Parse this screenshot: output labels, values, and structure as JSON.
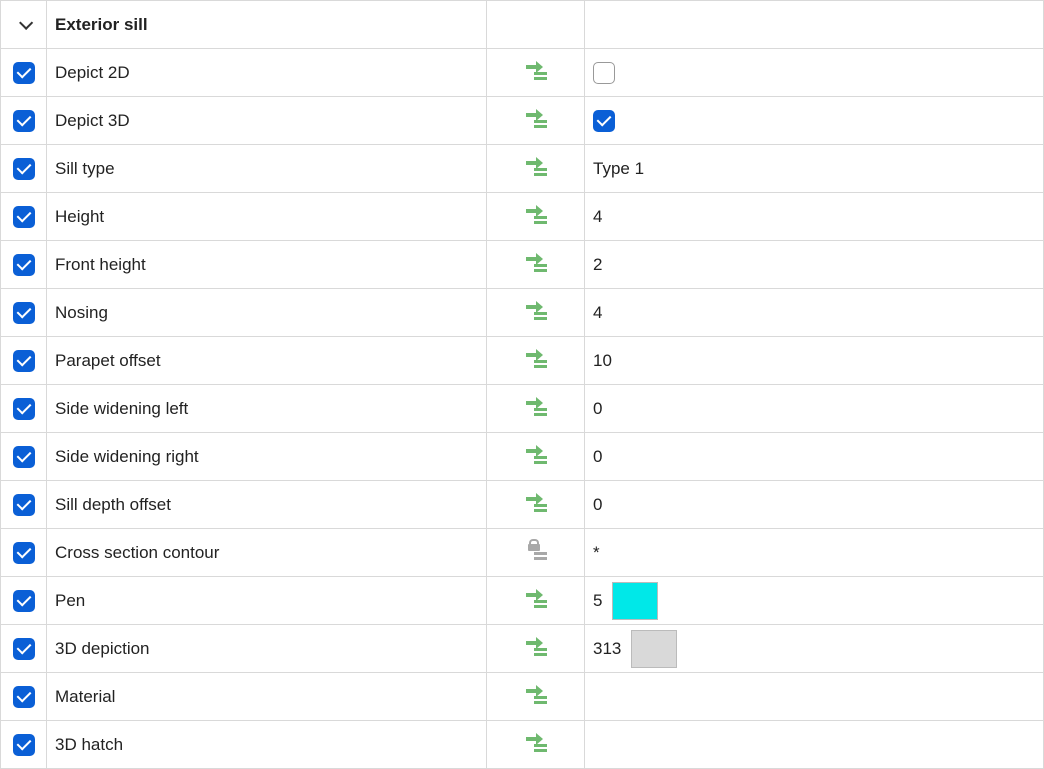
{
  "section": {
    "title": "Exterior sill",
    "expanded": true
  },
  "rows": [
    {
      "enabled": true,
      "label": "Depict 2D",
      "icon": "transfer",
      "value_type": "checkbox",
      "value_checked": false
    },
    {
      "enabled": true,
      "label": "Depict 3D",
      "icon": "transfer",
      "value_type": "checkbox",
      "value_checked": true
    },
    {
      "enabled": true,
      "label": "Sill type",
      "icon": "transfer",
      "value_type": "text",
      "value": "Type 1"
    },
    {
      "enabled": true,
      "label": "Height",
      "icon": "transfer",
      "value_type": "text",
      "value": "4"
    },
    {
      "enabled": true,
      "label": "Front height",
      "icon": "transfer",
      "value_type": "text",
      "value": "2"
    },
    {
      "enabled": true,
      "label": "Nosing",
      "icon": "transfer",
      "value_type": "text",
      "value": "4"
    },
    {
      "enabled": true,
      "label": "Parapet offset",
      "icon": "transfer",
      "value_type": "text",
      "value": "10"
    },
    {
      "enabled": true,
      "label": "Side widening left",
      "icon": "transfer",
      "value_type": "text",
      "value": "0"
    },
    {
      "enabled": true,
      "label": "Side widening right",
      "icon": "transfer",
      "value_type": "text",
      "value": "0"
    },
    {
      "enabled": true,
      "label": "Sill depth offset",
      "icon": "transfer",
      "value_type": "text",
      "value": "0"
    },
    {
      "enabled": true,
      "label": "Cross section contour",
      "icon": "lock",
      "value_type": "text",
      "value": "*"
    },
    {
      "enabled": true,
      "label": "Pen",
      "icon": "transfer",
      "value_type": "swatch",
      "value": "5",
      "swatch_color": "#00e8e8"
    },
    {
      "enabled": true,
      "label": "3D depiction",
      "icon": "transfer",
      "value_type": "swatch",
      "value": "313",
      "swatch_color": "#d9d9d9"
    },
    {
      "enabled": true,
      "label": "Material",
      "icon": "transfer",
      "value_type": "text",
      "value": ""
    },
    {
      "enabled": true,
      "label": "3D hatch",
      "icon": "transfer",
      "value_type": "text",
      "value": ""
    }
  ]
}
